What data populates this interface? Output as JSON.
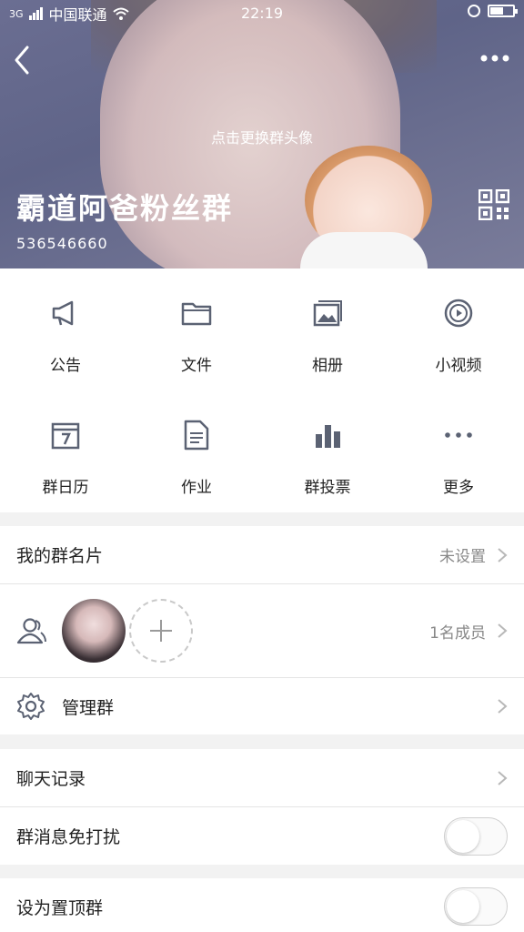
{
  "status_bar": {
    "carrier": "中国联通",
    "signal_label": "3G",
    "time": "22:19",
    "battery_level": 0.6
  },
  "header": {
    "change_avatar_hint": "点击更换群头像",
    "group_name": "霸道阿爸粉丝群",
    "group_id": "536546660"
  },
  "grid": [
    {
      "label": "公告",
      "icon": "megaphone-icon"
    },
    {
      "label": "文件",
      "icon": "folder-icon"
    },
    {
      "label": "相册",
      "icon": "photo-album-icon"
    },
    {
      "label": "小视频",
      "icon": "video-icon"
    },
    {
      "label": "群日历",
      "icon": "calendar-icon"
    },
    {
      "label": "作业",
      "icon": "document-icon"
    },
    {
      "label": "群投票",
      "icon": "bar-chart-icon"
    },
    {
      "label": "更多",
      "icon": "more-dots-icon"
    }
  ],
  "list": {
    "card": {
      "title": "我的群名片",
      "value": "未设置"
    },
    "members": {
      "count_label": "1名成员"
    },
    "manage": {
      "title": "管理群"
    },
    "chat_history": {
      "title": "聊天记录"
    },
    "mute": {
      "title": "群消息免打扰",
      "on": false
    },
    "pin": {
      "title": "设为置顶群",
      "on": false
    }
  },
  "colors": {
    "icon": "#5b6273",
    "chevron": "#b8b8b8",
    "header_bg": "#62668a"
  }
}
